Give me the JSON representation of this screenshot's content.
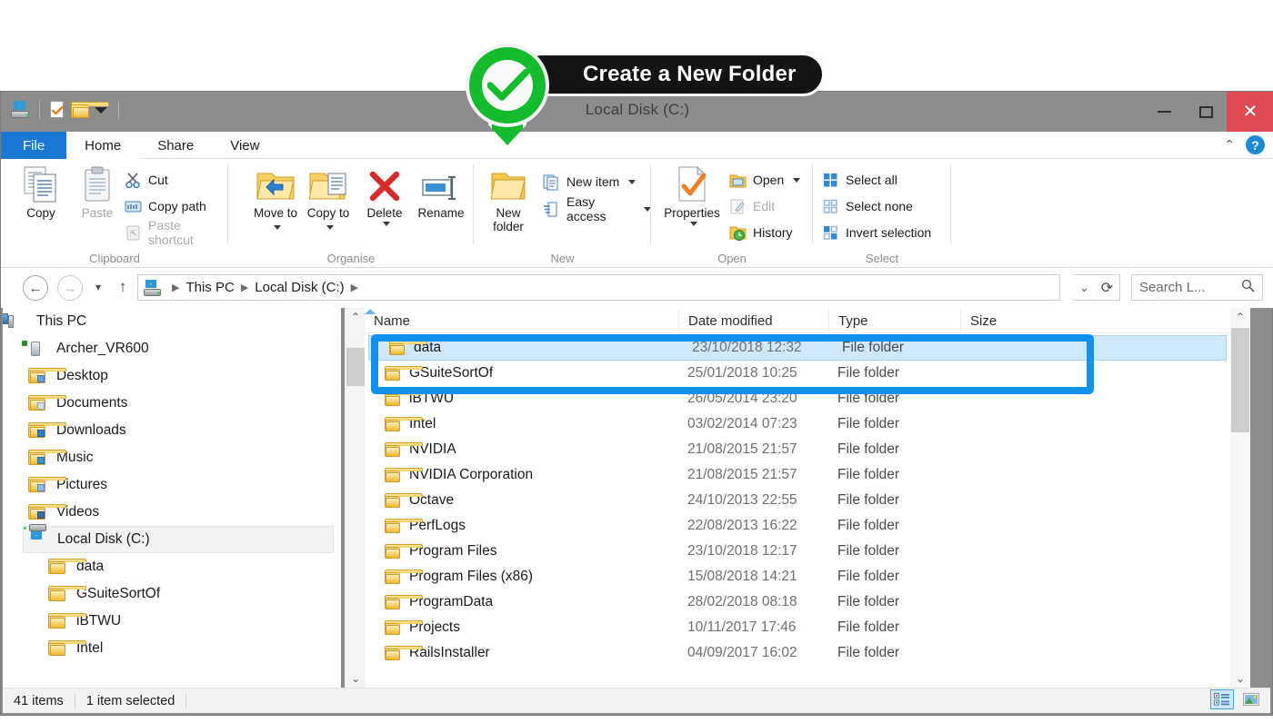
{
  "window": {
    "title": "Local Disk (C:)",
    "quick_access": [
      "drive-icon",
      "properties-icon",
      "new-folder-icon",
      "customize-dropdown"
    ],
    "controls": {
      "minimize": "—",
      "maximize": "▢",
      "close": "✕"
    },
    "close_color": "#e04a52"
  },
  "annotation": {
    "callout_label": "Create a New Folder",
    "pin_color": "#14bc2d",
    "highlight_color": "#1292f0",
    "marker_icon": "check-circle-pin-icon"
  },
  "ribbon": {
    "tabs": [
      {
        "label": "File",
        "active": false,
        "is_file_menu": true
      },
      {
        "label": "Home",
        "active": true,
        "is_file_menu": false
      },
      {
        "label": "Share",
        "active": false,
        "is_file_menu": false
      },
      {
        "label": "View",
        "active": false,
        "is_file_menu": false
      }
    ],
    "collapse_icon": "chevron-up-icon",
    "help_icon": "help-question-icon",
    "groups": [
      {
        "title": "Clipboard",
        "big_buttons": [
          {
            "label": "Copy",
            "icon": "copy-icon",
            "disabled": false
          },
          {
            "label": "Paste",
            "icon": "paste-icon",
            "disabled": true
          }
        ],
        "small_buttons": [
          {
            "label": "Cut",
            "icon": "scissors-icon",
            "disabled": false
          },
          {
            "label": "Copy path",
            "icon": "copy-path-icon",
            "disabled": false
          },
          {
            "label": "Paste shortcut",
            "icon": "paste-shortcut-icon",
            "disabled": true
          }
        ]
      },
      {
        "title": "Organise",
        "big_buttons": [
          {
            "label": "Move to",
            "icon": "move-to-icon",
            "has_dropdown": true
          },
          {
            "label": "Copy to",
            "icon": "copy-to-icon",
            "has_dropdown": true
          },
          {
            "label": "Delete",
            "icon": "delete-x-icon",
            "has_dropdown": true
          },
          {
            "label": "Rename",
            "icon": "rename-icon",
            "has_dropdown": false
          }
        ],
        "small_buttons": []
      },
      {
        "title": "New",
        "big_buttons": [
          {
            "label": "New folder",
            "icon": "new-folder-icon",
            "has_dropdown": false
          }
        ],
        "small_buttons": [
          {
            "label": "New item",
            "icon": "new-item-icon",
            "has_dropdown": true
          },
          {
            "label": "Easy access",
            "icon": "easy-access-icon",
            "has_dropdown": true
          }
        ]
      },
      {
        "title": "Open",
        "big_buttons": [
          {
            "label": "Properties",
            "icon": "properties-icon",
            "has_dropdown": true
          }
        ],
        "small_buttons": [
          {
            "label": "Open",
            "icon": "open-folder-icon",
            "has_dropdown": true,
            "disabled": false
          },
          {
            "label": "Edit",
            "icon": "edit-pencil-icon",
            "disabled": true
          },
          {
            "label": "History",
            "icon": "history-clock-icon",
            "disabled": false
          }
        ]
      },
      {
        "title": "Select",
        "big_buttons": [],
        "small_buttons": [
          {
            "label": "Select all",
            "icon": "select-all-icon",
            "disabled": false
          },
          {
            "label": "Select none",
            "icon": "select-none-icon",
            "disabled": false
          },
          {
            "label": "Invert selection",
            "icon": "invert-selection-icon",
            "disabled": false
          }
        ]
      }
    ]
  },
  "addressbar": {
    "back_icon": "back-arrow-icon",
    "forward_icon": "forward-arrow-icon",
    "recent_icon": "chevron-down-icon",
    "up_icon": "up-arrow-icon",
    "path_icon": "drive-icon",
    "breadcrumbs": [
      "This PC",
      "Local Disk (C:)"
    ],
    "dropdown_icon": "chevron-down-icon",
    "refresh_icon": "refresh-icon",
    "search_placeholder": "Search L...",
    "search_icon": "magnifier-icon"
  },
  "navpane": {
    "items": [
      {
        "label": "This PC",
        "icon": "this-pc-icon",
        "indent": 0,
        "selected": false
      },
      {
        "label": "Archer_VR600",
        "icon": "router-icon",
        "indent": 1,
        "selected": false
      },
      {
        "label": "Desktop",
        "icon": "desktop-folder-icon",
        "indent": 1,
        "selected": false
      },
      {
        "label": "Documents",
        "icon": "documents-folder-icon",
        "indent": 1,
        "selected": false
      },
      {
        "label": "Downloads",
        "icon": "downloads-folder-icon",
        "indent": 1,
        "selected": false
      },
      {
        "label": "Music",
        "icon": "music-folder-icon",
        "indent": 1,
        "selected": false
      },
      {
        "label": "Pictures",
        "icon": "pictures-folder-icon",
        "indent": 1,
        "selected": false
      },
      {
        "label": "Videos",
        "icon": "videos-folder-icon",
        "indent": 1,
        "selected": false
      },
      {
        "label": "Local Disk (C:)",
        "icon": "drive-icon",
        "indent": 1,
        "selected": true
      },
      {
        "label": "data",
        "icon": "folder-icon",
        "indent": 2,
        "selected": false
      },
      {
        "label": "GSuiteSortOf",
        "icon": "folder-icon",
        "indent": 2,
        "selected": false
      },
      {
        "label": "iBTWU",
        "icon": "folder-icon",
        "indent": 2,
        "selected": false
      },
      {
        "label": "Intel",
        "icon": "folder-icon",
        "indent": 2,
        "selected": false
      }
    ]
  },
  "filelist": {
    "columns": [
      {
        "label": "Name",
        "sorted": true,
        "sort_dir": "asc"
      },
      {
        "label": "Date modified",
        "sorted": false
      },
      {
        "label": "Type",
        "sorted": false
      },
      {
        "label": "Size",
        "sorted": false
      }
    ],
    "rows": [
      {
        "name": "data",
        "date": "23/10/2018 12:32",
        "type": "File folder",
        "size": "",
        "selected": true
      },
      {
        "name": "GSuiteSortOf",
        "date": "25/01/2018 10:25",
        "type": "File folder",
        "size": "",
        "selected": false
      },
      {
        "name": "iBTWU",
        "date": "26/05/2014 23:20",
        "type": "File folder",
        "size": "",
        "selected": false
      },
      {
        "name": "Intel",
        "date": "03/02/2014 07:23",
        "type": "File folder",
        "size": "",
        "selected": false
      },
      {
        "name": "NVIDIA",
        "date": "21/08/2015 21:57",
        "type": "File folder",
        "size": "",
        "selected": false
      },
      {
        "name": "NVIDIA Corporation",
        "date": "21/08/2015 21:57",
        "type": "File folder",
        "size": "",
        "selected": false
      },
      {
        "name": "Octave",
        "date": "24/10/2013 22:55",
        "type": "File folder",
        "size": "",
        "selected": false
      },
      {
        "name": "PerfLogs",
        "date": "22/08/2013 16:22",
        "type": "File folder",
        "size": "",
        "selected": false
      },
      {
        "name": "Program Files",
        "date": "23/10/2018 12:17",
        "type": "File folder",
        "size": "",
        "selected": false
      },
      {
        "name": "Program Files (x86)",
        "date": "15/08/2018 14:21",
        "type": "File folder",
        "size": "",
        "selected": false
      },
      {
        "name": "ProgramData",
        "date": "28/02/2018 08:18",
        "type": "File folder",
        "size": "",
        "selected": false
      },
      {
        "name": "Projects",
        "date": "10/11/2017 17:46",
        "type": "File folder",
        "size": "",
        "selected": false
      },
      {
        "name": "RailsInstaller",
        "date": "04/09/2017 16:02",
        "type": "File folder",
        "size": "",
        "selected": false
      }
    ]
  },
  "statusbar": {
    "item_count": "41 items",
    "selection": "1 item selected",
    "view_details_icon": "details-view-icon",
    "view_thumbnails_icon": "large-icons-view-icon"
  }
}
